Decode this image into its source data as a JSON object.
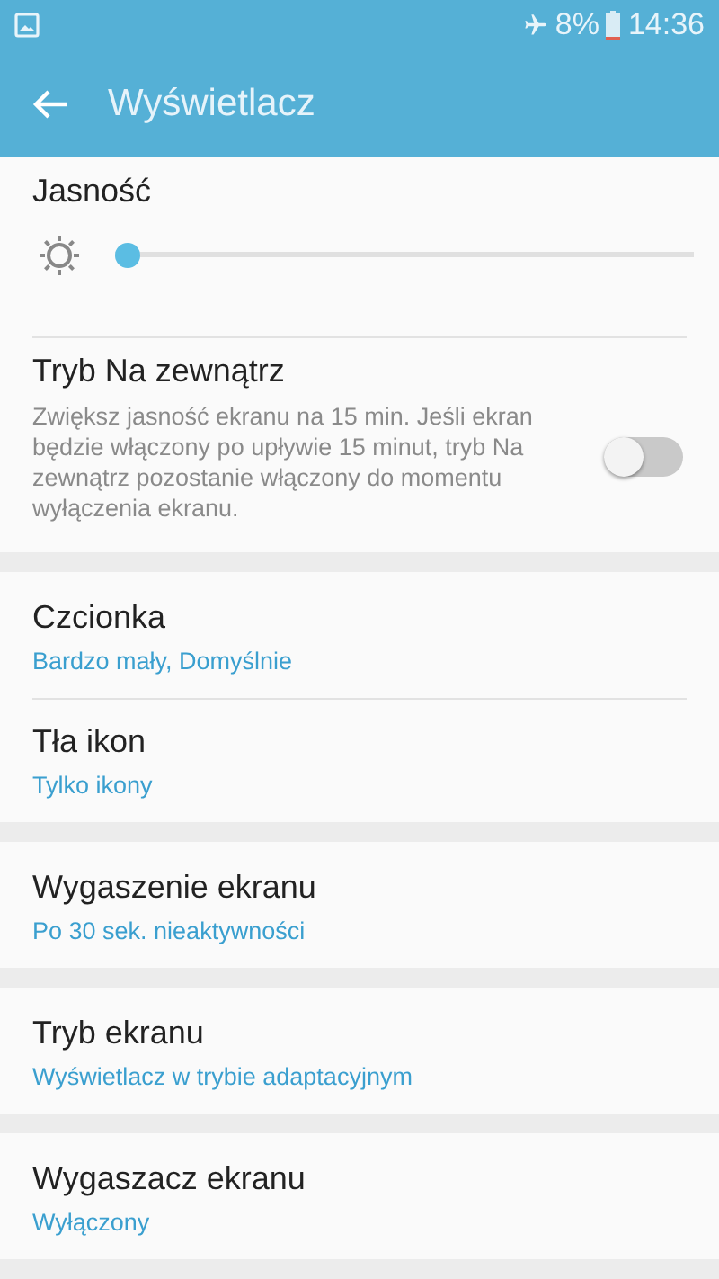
{
  "status_bar": {
    "battery": "8%",
    "time": "14:36"
  },
  "toolbar": {
    "title": "Wyświetlacz"
  },
  "sections": [
    {
      "items": [
        {
          "kind": "slider",
          "title": "Jasność",
          "level": 0.0
        },
        {
          "kind": "toggle",
          "title": "Tryb Na zewnątrz",
          "description": "Zwiększ jasność ekranu na 15 min. Jeśli ekran będzie włączony po upływie 15 minut, tryb Na zewnątrz pozostanie włączony do momentu wyłączenia ekranu.",
          "on": false
        }
      ]
    },
    {
      "items": [
        {
          "kind": "option",
          "title": "Czcionka",
          "value": "Bardzo mały, Domyślnie"
        },
        {
          "kind": "option",
          "title": "Tła ikon",
          "value": "Tylko ikony"
        }
      ]
    },
    {
      "items": [
        {
          "kind": "option",
          "title": "Wygaszenie ekranu",
          "value": "Po 30 sek. nieaktywności"
        }
      ]
    },
    {
      "items": [
        {
          "kind": "option",
          "title": "Tryb ekranu",
          "value": "Wyświetlacz w trybie adaptacyjnym"
        }
      ]
    },
    {
      "items": [
        {
          "kind": "option",
          "title": "Wygaszacz ekranu",
          "value": "Wyłączony"
        }
      ]
    }
  ]
}
